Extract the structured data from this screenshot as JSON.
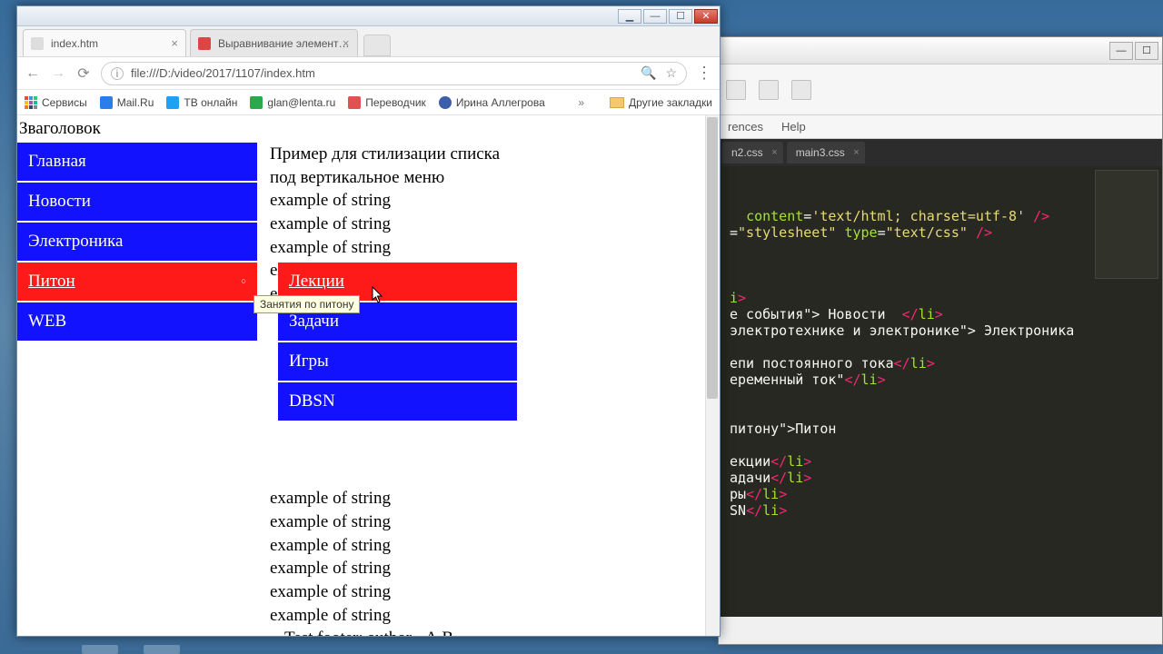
{
  "browser": {
    "tabs": [
      {
        "label": "index.htm",
        "active": true
      },
      {
        "label": "Выравнивание элемент…",
        "active": false
      }
    ],
    "url": "file:///D:/video/2017/1107/index.htm",
    "bookmarks": {
      "services": "Сервисы",
      "items": [
        {
          "label": "Mail.Ru",
          "color": "#2b7de9"
        },
        {
          "label": "ТВ онлайн",
          "color": "#1da1f2"
        },
        {
          "label": "glan@lenta.ru",
          "color": "#2aa84a"
        },
        {
          "label": "Переводчик",
          "color": "#e05252"
        },
        {
          "label": "Ирина Аллегрова",
          "color": "#3b5fab"
        }
      ],
      "more": "»",
      "other": "Другие закладки"
    }
  },
  "page": {
    "title": "Зваголовок",
    "menu": [
      {
        "label": "Главная"
      },
      {
        "label": "Новости"
      },
      {
        "label": "Электроника"
      },
      {
        "label": "Питон",
        "active": true
      },
      {
        "label": "WEB"
      }
    ],
    "submenu": [
      {
        "label": "Лекции",
        "active": true
      },
      {
        "label": "Задачи"
      },
      {
        "label": "Игры"
      },
      {
        "label": "DBSN"
      }
    ],
    "tooltip": "Занятия по питону",
    "content_heading": "Пример для стилизации списка под вертикальное меню",
    "lines_top": [
      "example of string",
      "example of string",
      "example of string",
      "example of string",
      "example of string"
    ],
    "lines_bottom": [
      "example of string",
      "example of string",
      "example of string",
      "example of string",
      "example of string",
      "example of string"
    ],
    "footer": "Test footer: author - A.B."
  },
  "editor": {
    "menu": {
      "refs": "rences",
      "help": "Help"
    },
    "tabs": [
      {
        "label": "n2.css"
      },
      {
        "label": "main3.css"
      }
    ],
    "code_lines": [
      [
        "attr",
        "content"
      ],
      [
        "text",
        "="
      ],
      [
        "str",
        "'text/html; charset=utf-8'"
      ],
      [
        "text",
        " "
      ],
      [
        "tag",
        "/>"
      ],
      "\n",
      [
        "text",
        "="
      ],
      [
        "str",
        "\"stylesheet\""
      ],
      [
        "text",
        " "
      ],
      [
        "attr",
        "type"
      ],
      [
        "text",
        "="
      ],
      [
        "str",
        "\"text/css\""
      ],
      [
        "text",
        " "
      ],
      [
        "tag",
        "/>"
      ],
      "\n\n\n\n",
      [
        "attr",
        "i"
      ],
      [
        "tag",
        ">"
      ],
      "\n",
      [
        "text",
        "е события\"> Новости  "
      ],
      [
        "tag",
        "</"
      ],
      [
        "attr",
        "li"
      ],
      [
        "tag",
        ">"
      ],
      "\n",
      [
        "text",
        "электротехнике и электронике\"> Электроника"
      ],
      "\n\n",
      [
        "text",
        "епи постоянного тока"
      ],
      [
        "tag",
        "</"
      ],
      [
        "attr",
        "li"
      ],
      [
        "tag",
        ">"
      ],
      "\n",
      [
        "text",
        "еременный ток\""
      ],
      [
        "tag",
        "</"
      ],
      [
        "attr",
        "li"
      ],
      [
        "tag",
        ">"
      ],
      "\n\n\n",
      [
        "text",
        "питону\">Питон"
      ],
      "\n\n",
      [
        "text",
        "екции"
      ],
      [
        "tag",
        "</"
      ],
      [
        "attr",
        "li"
      ],
      [
        "tag",
        ">"
      ],
      "\n",
      [
        "text",
        "адачи"
      ],
      [
        "tag",
        "</"
      ],
      [
        "attr",
        "li"
      ],
      [
        "tag",
        ">"
      ],
      "\n",
      [
        "text",
        "ры"
      ],
      [
        "tag",
        "</"
      ],
      [
        "attr",
        "li"
      ],
      [
        "tag",
        ">"
      ],
      "\n",
      [
        "text",
        "SN"
      ],
      [
        "tag",
        "</"
      ],
      [
        "attr",
        "li"
      ],
      [
        "tag",
        ">"
      ]
    ]
  }
}
